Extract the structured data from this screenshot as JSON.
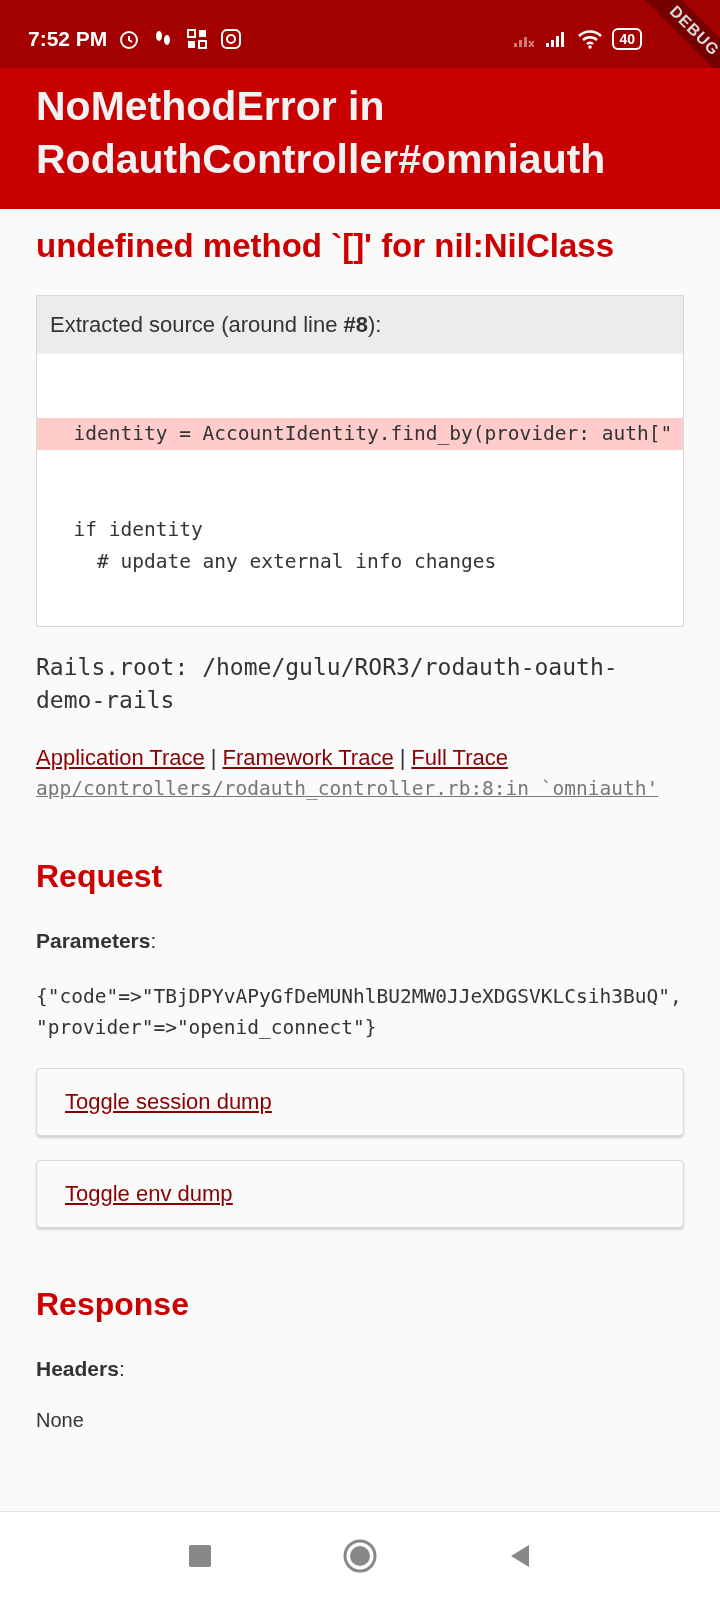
{
  "status_bar": {
    "time": "7:52 PM",
    "battery": "40",
    "debug_banner": "DEBUG"
  },
  "header": {
    "title_lines": [
      "NoMethodError in",
      "RodauthController#omniauth"
    ]
  },
  "error_message": "undefined method `[]' for nil:NilClass",
  "source": {
    "title": "Extracted source (around line **#8**):",
    "lines": [
      {
        "text": "  identity = AccountIdentity.find_by(provider: auth[\"",
        "highlighted": true
      },
      {
        "text": "  if identity",
        "highlighted": false
      },
      {
        "text": "    # update any external info changes",
        "highlighted": false
      }
    ]
  },
  "rails_root": "Rails.root: /home/gulu/ROR3/rodauth-oauth-demo-rails",
  "trace_links": [
    "Application Trace",
    "Framework Trace",
    "Full Trace"
  ],
  "trace_separator": "|",
  "trace_line": "app/controllers/rodauth_controller.rb:8:in `omniauth'",
  "request": {
    "heading": "Request",
    "label": "**Parameters**:",
    "params_lines": [
      "{\"code\"=>\"TBjDPYvAPyGfDeMUNhlBU2MW0JJeXDGSVKLCsih3BuQ\",",
      "\"provider\"=>\"openid_connect\"}"
    ],
    "toggles": [
      "Toggle session dump",
      "Toggle env dump"
    ]
  },
  "response": {
    "heading": "Response",
    "label": "**Headers**:",
    "value": "None"
  }
}
